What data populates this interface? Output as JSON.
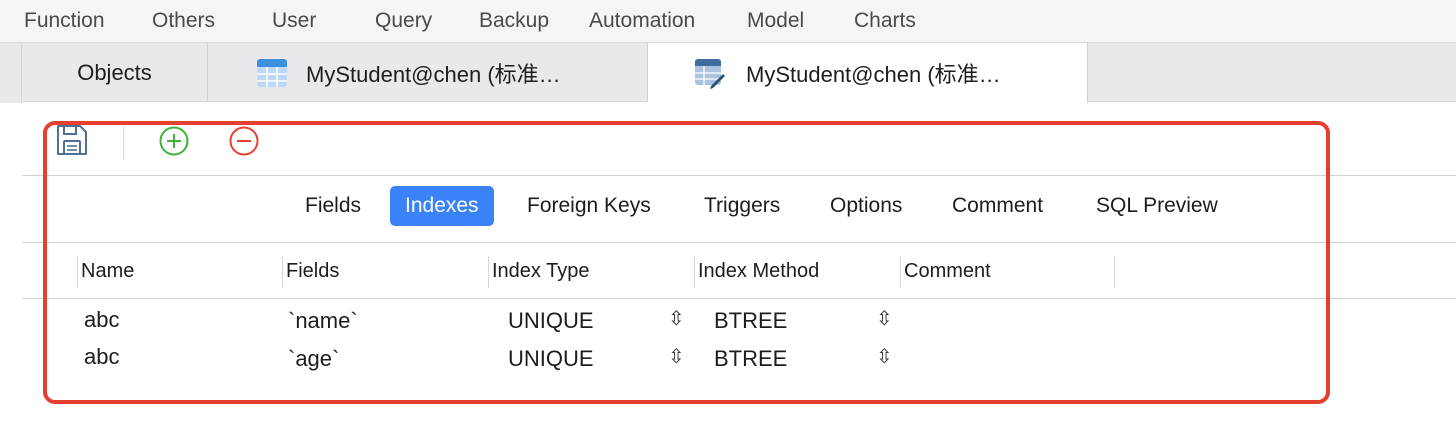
{
  "menu": [
    "Function",
    "Others",
    "User",
    "Query",
    "Backup",
    "Automation",
    "Model",
    "Charts"
  ],
  "tabs": {
    "objects": "Objects",
    "table_tab": "MyStudent@chen (标准…",
    "design_tab": "MyStudent@chen (标准…"
  },
  "toolbar": {
    "save": "save-icon",
    "add": "add-icon",
    "remove": "remove-icon"
  },
  "segments": [
    "Fields",
    "Indexes",
    "Foreign Keys",
    "Triggers",
    "Options",
    "Comment",
    "SQL Preview"
  ],
  "active_segment": "Indexes",
  "columns": [
    "Name",
    "Fields",
    "Index Type",
    "Index Method",
    "Comment"
  ],
  "rows": [
    {
      "name": "abc",
      "fields": "`name`",
      "type": "UNIQUE",
      "method": "BTREE",
      "comment": ""
    },
    {
      "name": "abc",
      "fields": "`age`",
      "type": "UNIQUE",
      "method": "BTREE",
      "comment": ""
    }
  ],
  "colors": {
    "accent": "#3a82f7",
    "add": "#3db33d",
    "remove": "#e5402f",
    "annotation": "#e5402f"
  }
}
